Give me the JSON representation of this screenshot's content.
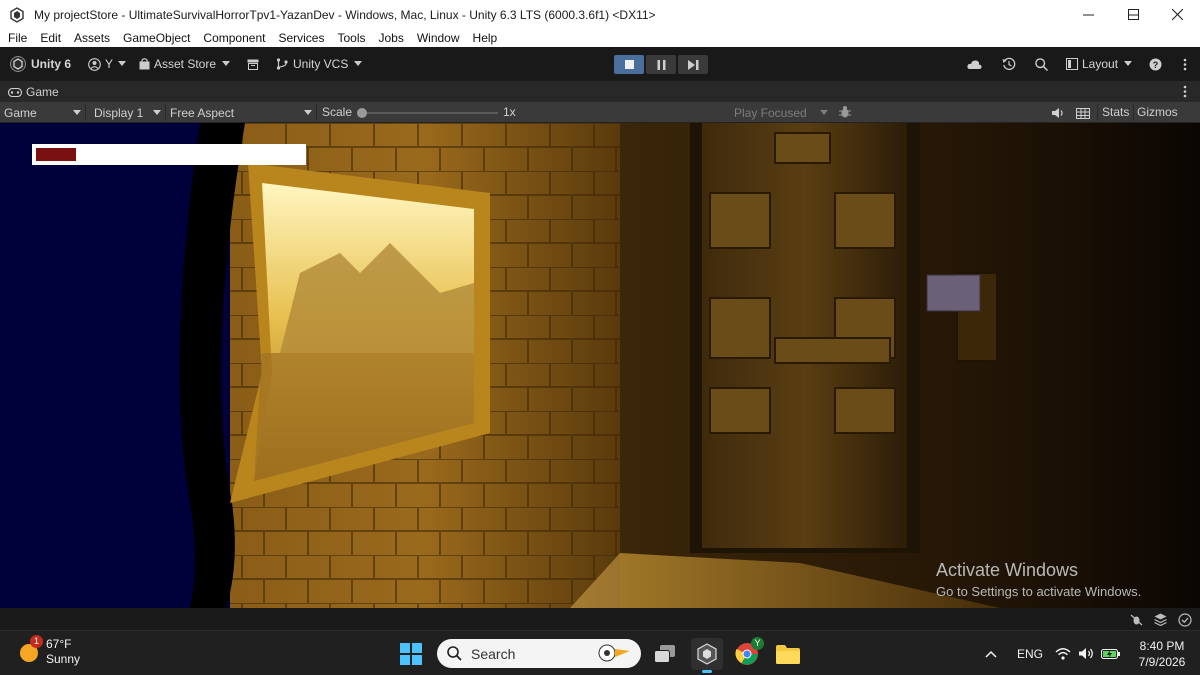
{
  "window": {
    "title": "My projectStore - UltimateSurvivalHorrorTpv1-YazanDev - Windows, Mac, Linux - Unity 6.3 LTS (6000.3.6f1) <DX11>"
  },
  "menu": [
    "File",
    "Edit",
    "Assets",
    "GameObject",
    "Component",
    "Services",
    "Tools",
    "Jobs",
    "Window",
    "Help"
  ],
  "toolbar": {
    "unity_label": "Unity 6",
    "account_label": "Y",
    "asset_store_label": "Asset Store",
    "vcs_label": "Unity VCS",
    "layout_label": "Layout"
  },
  "game_tab": {
    "label": "Game"
  },
  "game_controls": {
    "mode": "Game",
    "display": "Display 1",
    "aspect": "Free Aspect",
    "scale_label": "Scale",
    "scale_value": "1x",
    "play_focused": "Play Focused",
    "stats": "Stats",
    "gizmos": "Gizmos"
  },
  "hud": {
    "health_fraction": 0.15
  },
  "watermark": {
    "line1": "Activate Windows",
    "line2": "Go to Settings to activate Windows."
  },
  "taskbar": {
    "weather_temp": "67°F",
    "weather_cond": "Sunny",
    "weather_badge": "1",
    "search_label": "Search",
    "language": "ENG",
    "time": "8:40 PM",
    "date": "7/9/2026",
    "chrome_badge": "Y"
  },
  "colors": {
    "accent_play": "#4a6f9b",
    "health": "#7a1010",
    "wall": "#7a5212"
  }
}
